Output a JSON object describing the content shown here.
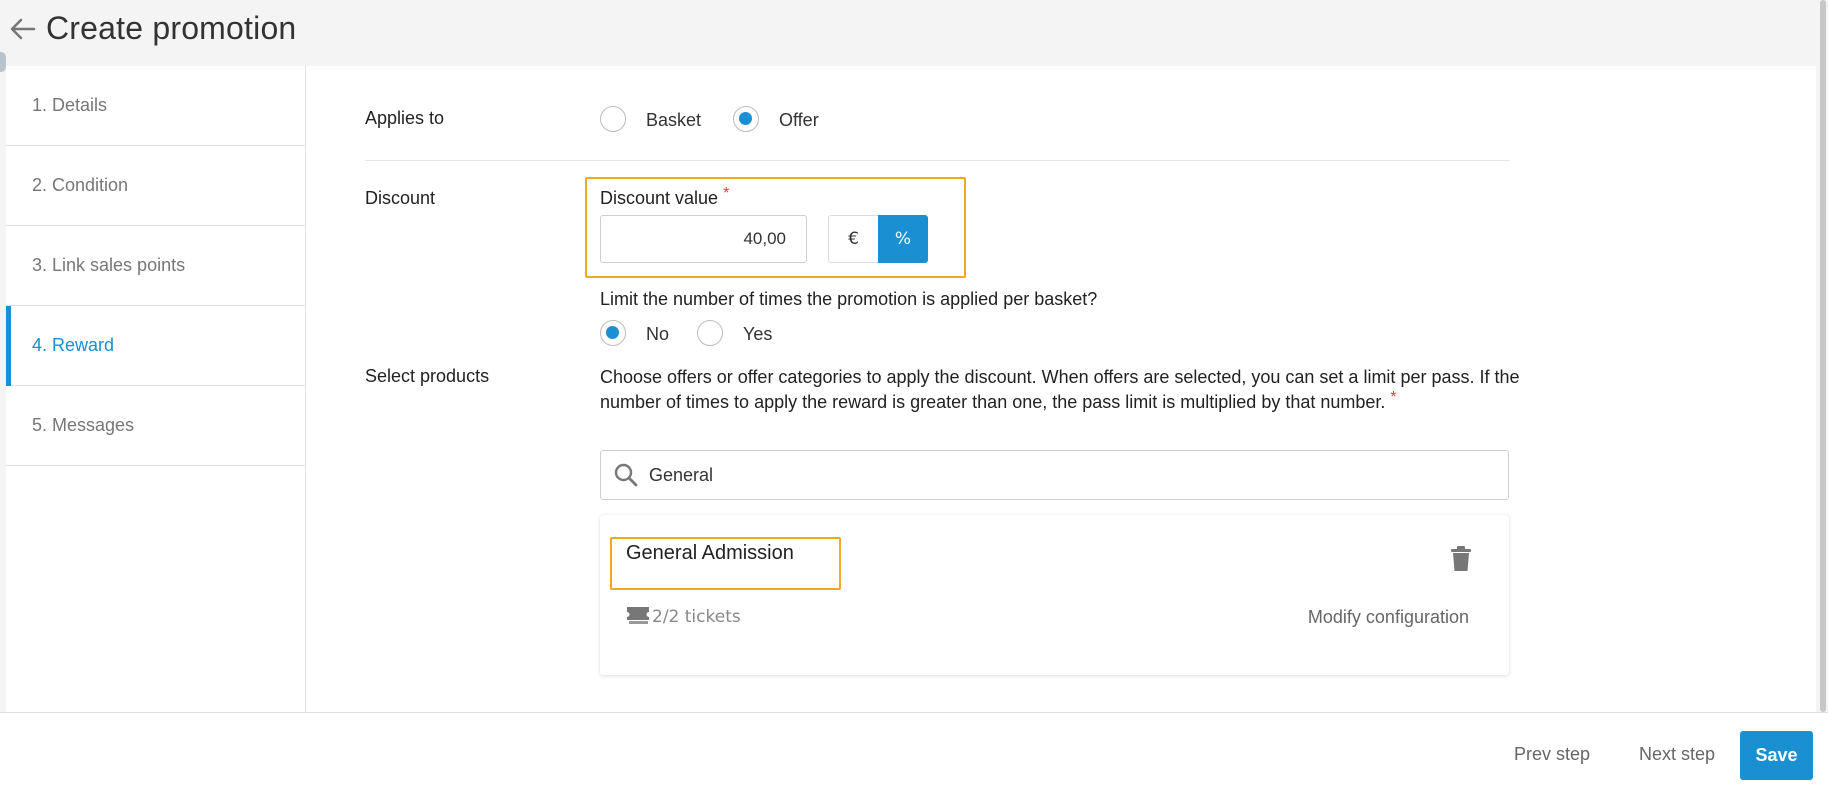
{
  "header": {
    "title": "Create promotion"
  },
  "steps": [
    {
      "label": "1. Details"
    },
    {
      "label": "2. Condition"
    },
    {
      "label": "3. Link sales points"
    },
    {
      "label": "4. Reward"
    },
    {
      "label": "5. Messages"
    }
  ],
  "applies_to": {
    "label": "Applies to",
    "options": [
      "Basket",
      "Offer"
    ],
    "selected": "Offer"
  },
  "discount": {
    "label": "Discount",
    "field_label": "Discount value",
    "required_mark": "*",
    "value": "40,00",
    "units": [
      "€",
      "%"
    ],
    "selected_unit": "%"
  },
  "limit": {
    "question": "Limit the number of times the promotion is applied per basket?",
    "options": [
      "No",
      "Yes"
    ],
    "selected": "No"
  },
  "products": {
    "label": "Select products",
    "description": "Choose offers or offer categories to apply the discount. When offers are selected, you can set a limit per pass. If the number of times to apply the reward is greater than one, the pass limit is multiplied by that number.",
    "required_mark": "*",
    "search_value": "General",
    "offer": {
      "title": "General Admission",
      "tickets": "2/2 tickets",
      "modify_label": "Modify configuration"
    }
  },
  "footer": {
    "prev_label": "Prev step",
    "next_label": "Next step",
    "save_label": "Save"
  },
  "colors": {
    "accent": "#1a8fd1",
    "highlight": "#f5a623",
    "required": "#e53935"
  }
}
